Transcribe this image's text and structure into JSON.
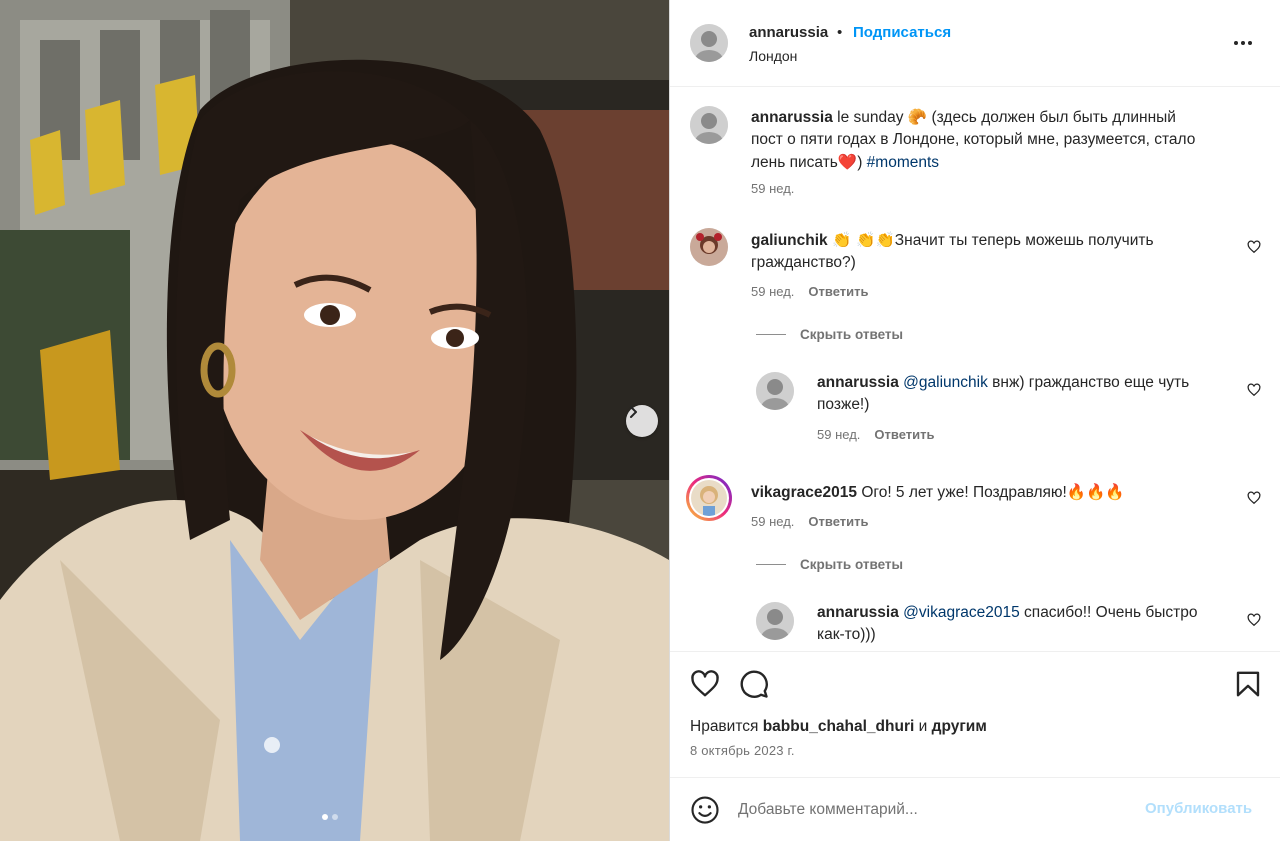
{
  "post": {
    "author": "annarussia",
    "separator": "•",
    "follow_label": "Подписаться",
    "location": "Лондон",
    "likes_prefix": "Нравится",
    "likes_user": "babbu_chahal_dhuri",
    "likes_and": "и",
    "likes_others": "другим",
    "date": "8 октябрь 2023 г.",
    "carousel_index": 1,
    "carousel_count": 2
  },
  "caption": {
    "user": "annarussia",
    "text_line1": "le sunday",
    "emoji1": "🥐",
    "text_line1b": "(здесь должен был быть длинный",
    "text_line2": "пост о пяти годах в Лондоне, который мне, разумеется, стало",
    "text_line3": "лень писать",
    "emoji_heart": "❤️",
    "text_line3b": ")",
    "hashtag": "#moments",
    "time": "59 нед."
  },
  "comments": [
    {
      "user": "galiunchik",
      "emoji": "👏 👏👏",
      "text1": "Значит ты теперь можешь получить",
      "text2": "гражданство?)",
      "time": "59 нед.",
      "reply_label": "Ответить",
      "hide_replies": "Скрыть ответы",
      "replies": [
        {
          "user": "annarussia",
          "mention": "@galiunchik",
          "text1": "внж) гражданство еще чуть",
          "text2": "позже!)",
          "time": "59 нед.",
          "reply_label": "Ответить"
        }
      ]
    },
    {
      "user": "vikagrace2015",
      "text1": "Ого! 5 лет уже! Поздравляю!",
      "emoji": "🔥🔥🔥",
      "time": "59 нед.",
      "reply_label": "Ответить",
      "hide_replies": "Скрыть ответы",
      "replies": [
        {
          "user": "annarussia",
          "mention": "@vikagrace2015",
          "text1": "спасибо!! Очень быстро",
          "text2": "как-то)))"
        }
      ]
    }
  ],
  "composer": {
    "placeholder": "Добавьте комментарий...",
    "publish_label": "Опубликовать"
  },
  "icons": {
    "like": "heart-icon",
    "comment": "comment-bubble-icon",
    "save": "bookmark-icon",
    "emoji": "smiley-icon",
    "more": "more-horizontal-icon",
    "next": "chevron-right-icon"
  },
  "colors": {
    "link": "#0095f6",
    "hashtag": "#00376b",
    "muted": "#737373",
    "publish_disabled": "#b2dffc"
  }
}
